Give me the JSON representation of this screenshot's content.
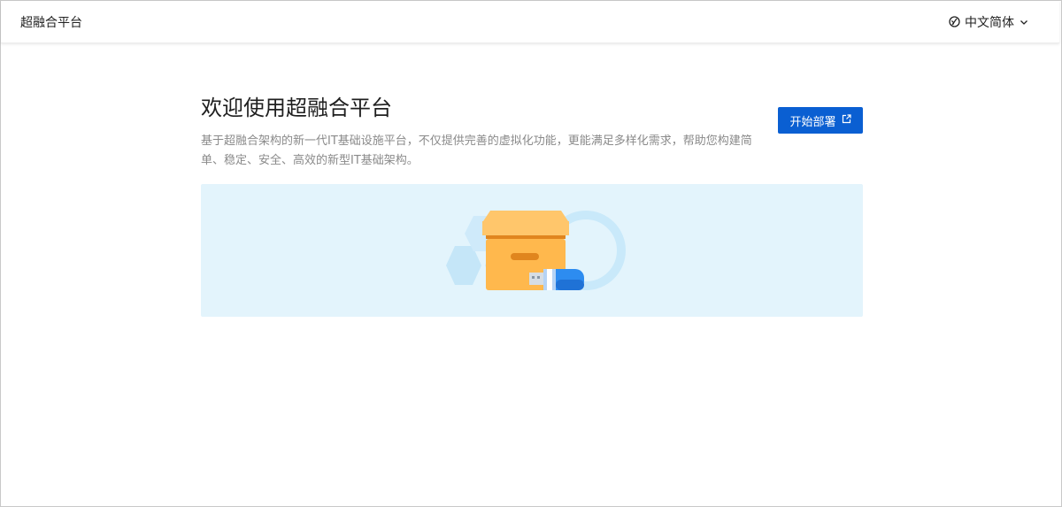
{
  "header": {
    "app_title": "超融合平台",
    "language": "中文简体",
    "language_icon": "globe-icon",
    "dropdown_icon": "chevron-down-icon"
  },
  "main": {
    "headline": "欢迎使用超融合平台",
    "description": "基于超融合架构的新一代IT基础设施平台，不仅提供完善的虚拟化功能，更能满足多样化需求，帮助您构建简单、稳定、安全、高效的新型IT基础架构。",
    "start_button": "开始部署",
    "start_button_icon": "external-link-icon"
  },
  "colors": {
    "accent": "#0a5fd2",
    "banner_bg": "#e3f4fc",
    "box": "#ffb84d",
    "usb": "#2d8cf0"
  }
}
